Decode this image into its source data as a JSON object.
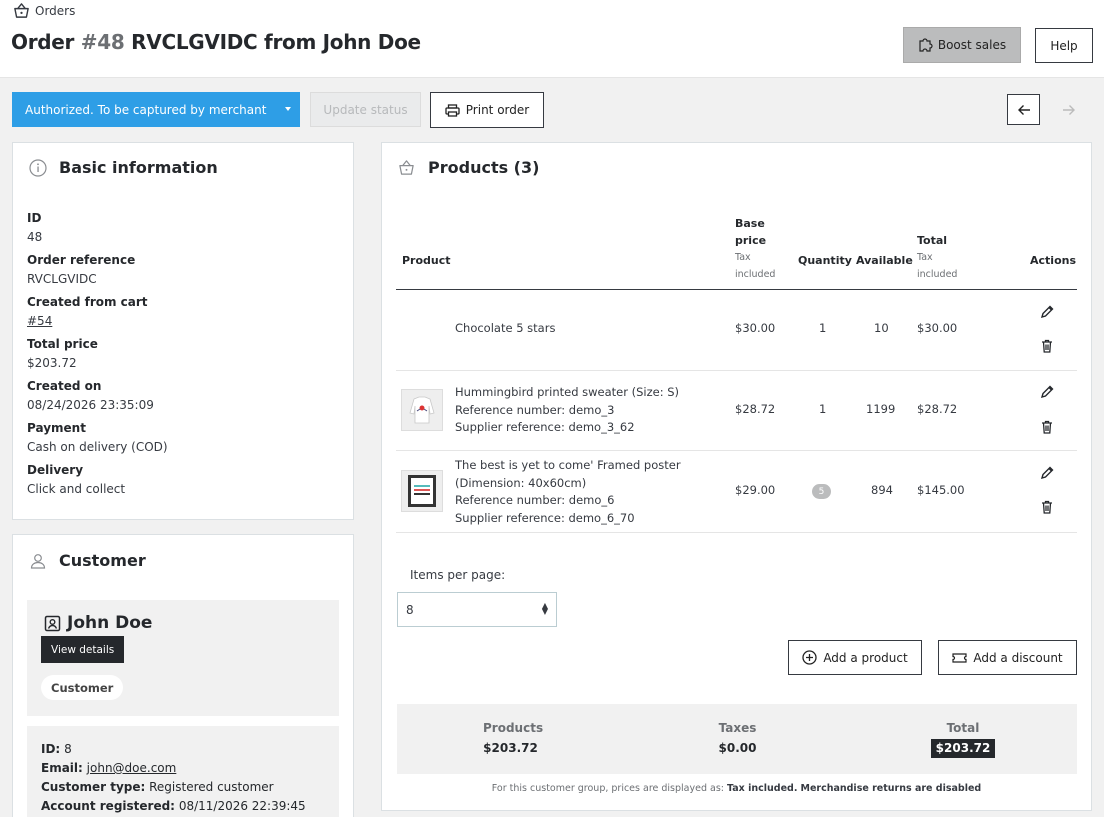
{
  "header": {
    "breadcrumb": "Orders",
    "title_prefix": "Order",
    "title_hash": "#48",
    "title_rest": "RVCLGVIDC from John Doe",
    "boost_label": "Boost sales",
    "help_label": "Help"
  },
  "toolbar": {
    "status_value": "Authorized. To be captured by merchant",
    "update_label": "Update status",
    "print_label": "Print order"
  },
  "basic": {
    "title": "Basic information",
    "fields": [
      {
        "label": "ID",
        "value": "48"
      },
      {
        "label": "Order reference",
        "value": "RVCLGVIDC"
      },
      {
        "label": "Created from cart",
        "value": "#54"
      },
      {
        "label": "Total price",
        "value": "$203.72"
      },
      {
        "label": "Created on",
        "value": "08/24/2026 23:35:09"
      },
      {
        "label": "Payment",
        "value": "Cash on delivery (COD)"
      },
      {
        "label": "Delivery",
        "value": "Click and collect"
      }
    ]
  },
  "customer": {
    "title": "Customer",
    "name": "John Doe",
    "view_details": "View details",
    "badge": "Customer",
    "id_label": "ID:",
    "id_value": "8",
    "email_label": "Email:",
    "email_value": "john@doe.com",
    "type_label": "Customer type:",
    "type_value": "Registered customer",
    "registered_label": "Account registered:",
    "registered_value": "08/11/2026 22:39:45"
  },
  "products": {
    "title": "Products (3)",
    "columns": {
      "product": "Product",
      "base_price_1": "Base",
      "base_price_2": "price",
      "base_price_sub1": "Tax",
      "base_price_sub2": "included",
      "quantity": "Quantity",
      "available": "Available",
      "total": "Total",
      "total_sub1": "Tax",
      "total_sub2": "included",
      "actions": "Actions"
    },
    "rows": [
      {
        "line1": "Chocolate 5 stars",
        "line2": "",
        "line3": "",
        "line4": "",
        "price": "$30.00",
        "qty": "1",
        "available": "10",
        "total": "$30.00"
      },
      {
        "line1": "Hummingbird printed sweater (Size: S)",
        "line2": "Reference number: demo_3",
        "line3": "Supplier reference: demo_3_62",
        "line4": "",
        "price": "$28.72",
        "qty": "1",
        "available": "1199",
        "total": "$28.72"
      },
      {
        "line1": "The best is yet to come' Framed poster",
        "line2": "(Dimension: 40x60cm)",
        "line3": "Reference number: demo_6",
        "line4": "Supplier reference: demo_6_70",
        "price": "$29.00",
        "qty": "5",
        "available": "894",
        "total": "$145.00"
      }
    ],
    "items_per_page_label": "Items per page:",
    "items_per_page_value": "8",
    "add_product": "Add a product",
    "add_discount": "Add a discount",
    "totals": {
      "products_label": "Products",
      "products_value": "$203.72",
      "taxes_label": "Taxes",
      "taxes_value": "$0.00",
      "total_label": "Total",
      "total_value": "$203.72"
    },
    "footnote_prefix": "For this customer group, prices are displayed as:",
    "footnote_tax": "Tax included",
    "footnote_returns": "Merchandise returns are disabled"
  }
}
